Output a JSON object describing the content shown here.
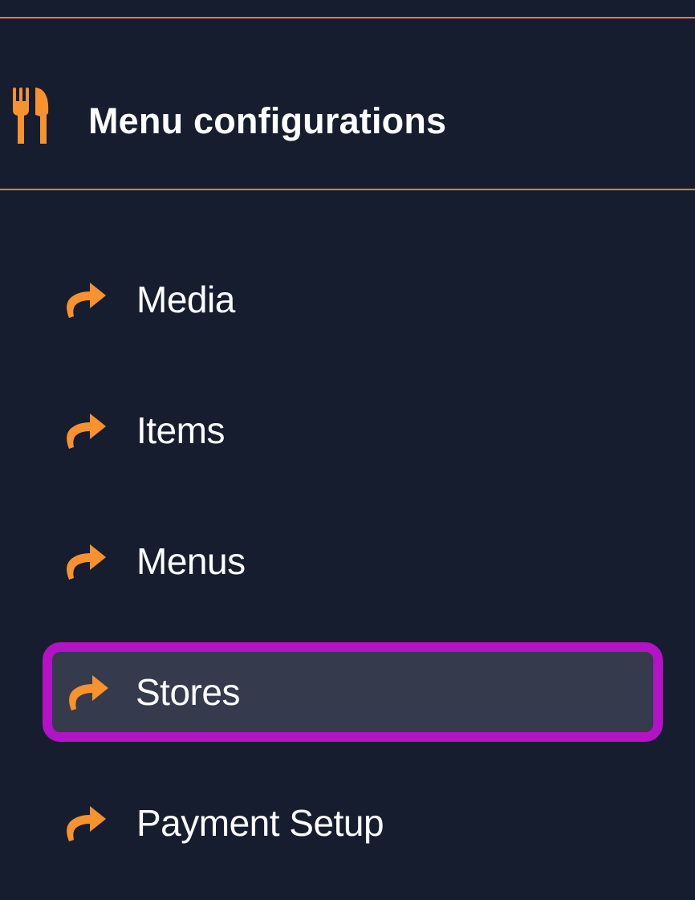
{
  "section": {
    "title": "Menu configurations",
    "icon": "utensils-icon"
  },
  "nav": {
    "items": [
      {
        "label": "Media",
        "icon": "arrow-forward-icon",
        "active": false
      },
      {
        "label": "Items",
        "icon": "arrow-forward-icon",
        "active": false
      },
      {
        "label": "Menus",
        "icon": "arrow-forward-icon",
        "active": false
      },
      {
        "label": "Stores",
        "icon": "arrow-forward-icon",
        "active": true
      },
      {
        "label": "Payment Setup",
        "icon": "arrow-forward-icon",
        "active": false
      }
    ]
  },
  "colors": {
    "background": "#161d2f",
    "accent": "#f7922e",
    "rule": "#d9853a",
    "active_background": "#353a4c",
    "highlight_border": "#b312c6",
    "text": "#ffffff"
  }
}
